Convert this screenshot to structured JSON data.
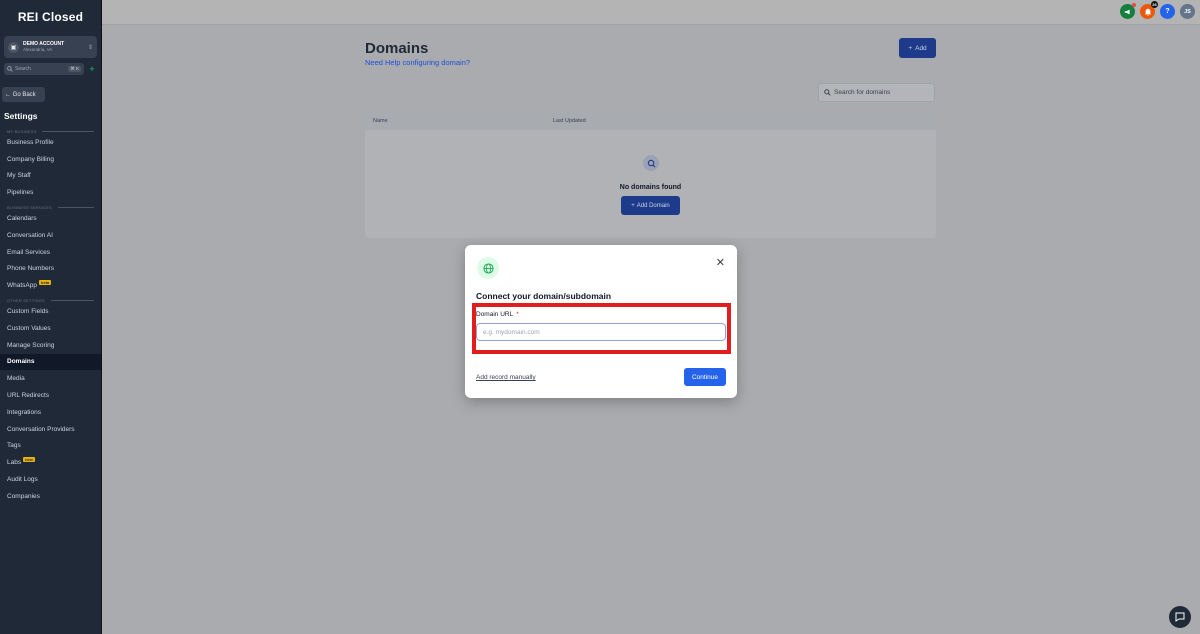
{
  "app": {
    "logo": "REI Closed"
  },
  "account": {
    "name": "DEMO ACCOUNT",
    "location": "Alexandria, VA"
  },
  "sidebar_search": {
    "placeholder": "Search",
    "shortcut": "⌘ K"
  },
  "go_back": "← Go Back",
  "settings_title": "Settings",
  "sidebar": {
    "groups": [
      {
        "label": "MY BUSINESS",
        "items": [
          "Business Profile",
          "Company Billing",
          "My Staff",
          "Pipelines"
        ]
      },
      {
        "label": "BUSINESS SERVICES",
        "items": [
          "Calendars",
          "Conversation AI",
          "Email Services",
          "Phone Numbers",
          "WhatsApp"
        ]
      },
      {
        "label": "OTHER SETTINGS",
        "items": [
          "Custom Fields",
          "Custom Values",
          "Manage Scoring",
          "Domains",
          "Media",
          "URL Redirects",
          "Integrations",
          "Conversation Providers",
          "Tags",
          "Labs",
          "Audit Logs",
          "Companies"
        ]
      }
    ],
    "badges": {
      "whatsapp": "beta",
      "labs": "new"
    },
    "active": "Domains"
  },
  "topbar": {
    "notification_count": "26",
    "help": "?",
    "user_initials": "JS"
  },
  "main": {
    "title": "Domains",
    "help_link": "Need Help configuring domain?",
    "add_label": "Add",
    "search_placeholder": "Search for domains",
    "table": {
      "columns": [
        "Name",
        "Last Updated"
      ]
    },
    "empty_text": "No domains found",
    "add_domain_label": "Add Domain"
  },
  "modal": {
    "title": "Connect your domain/subdomain",
    "field_label": "Domain URL",
    "required_mark": "*",
    "input_value": "",
    "input_placeholder": "e.g. mydomain.com",
    "manual_link": "Add record manually",
    "continue_label": "Continue"
  },
  "colors": {
    "primary": "#2563eb",
    "highlight": "#e11d1d",
    "sidebar_bg": "#1f2937",
    "badge": "#eab308"
  }
}
